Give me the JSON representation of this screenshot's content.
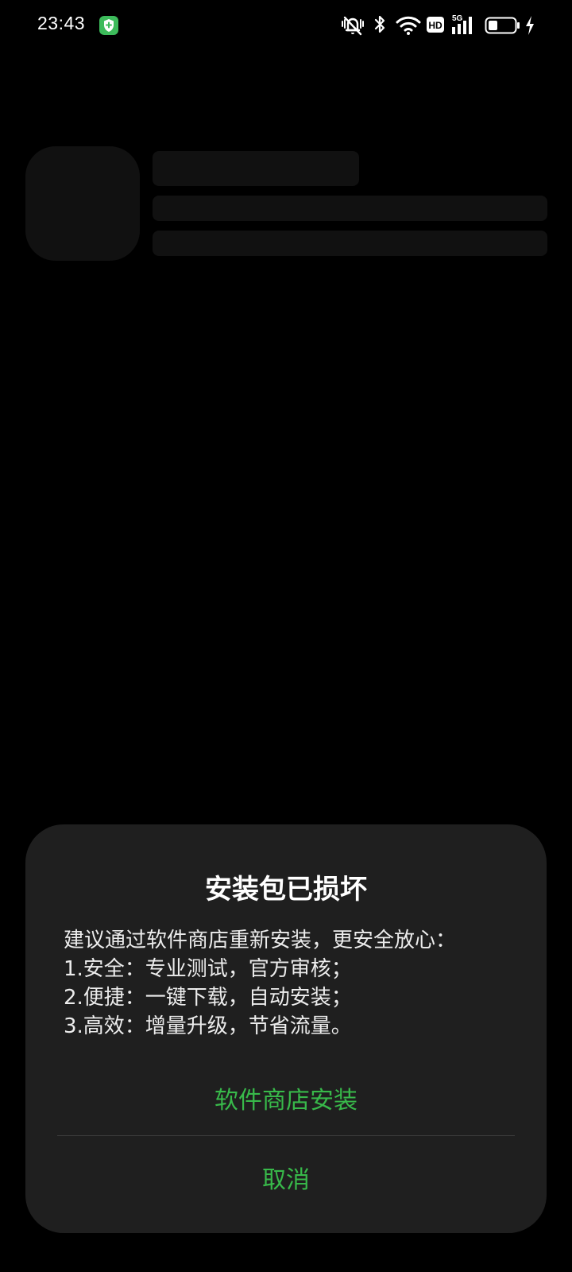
{
  "status_bar": {
    "time": "23:43",
    "hd_label": "HD",
    "network_label": "5G",
    "icons": [
      "secure-app-notification-icon",
      "mute-vibrate-icon",
      "bluetooth-icon",
      "wifi-icon",
      "hd-voice-icon",
      "signal-5g-icon",
      "battery-icon",
      "charging-icon"
    ]
  },
  "dialog": {
    "title": "安装包已损坏",
    "body": [
      "建议通过软件商店重新安装，更安全放心：",
      "1.安全：专业测试，官方审核；",
      "2.便捷：一键下载，自动安装；",
      "3.高效：增量升级，节省流量。"
    ],
    "primary_button": "软件商店安装",
    "cancel_button": "取消"
  },
  "colors": {
    "background": "#000000",
    "dialog_background": "#1f1f1f",
    "accent": "#38b94a",
    "skeleton": "#111111"
  }
}
